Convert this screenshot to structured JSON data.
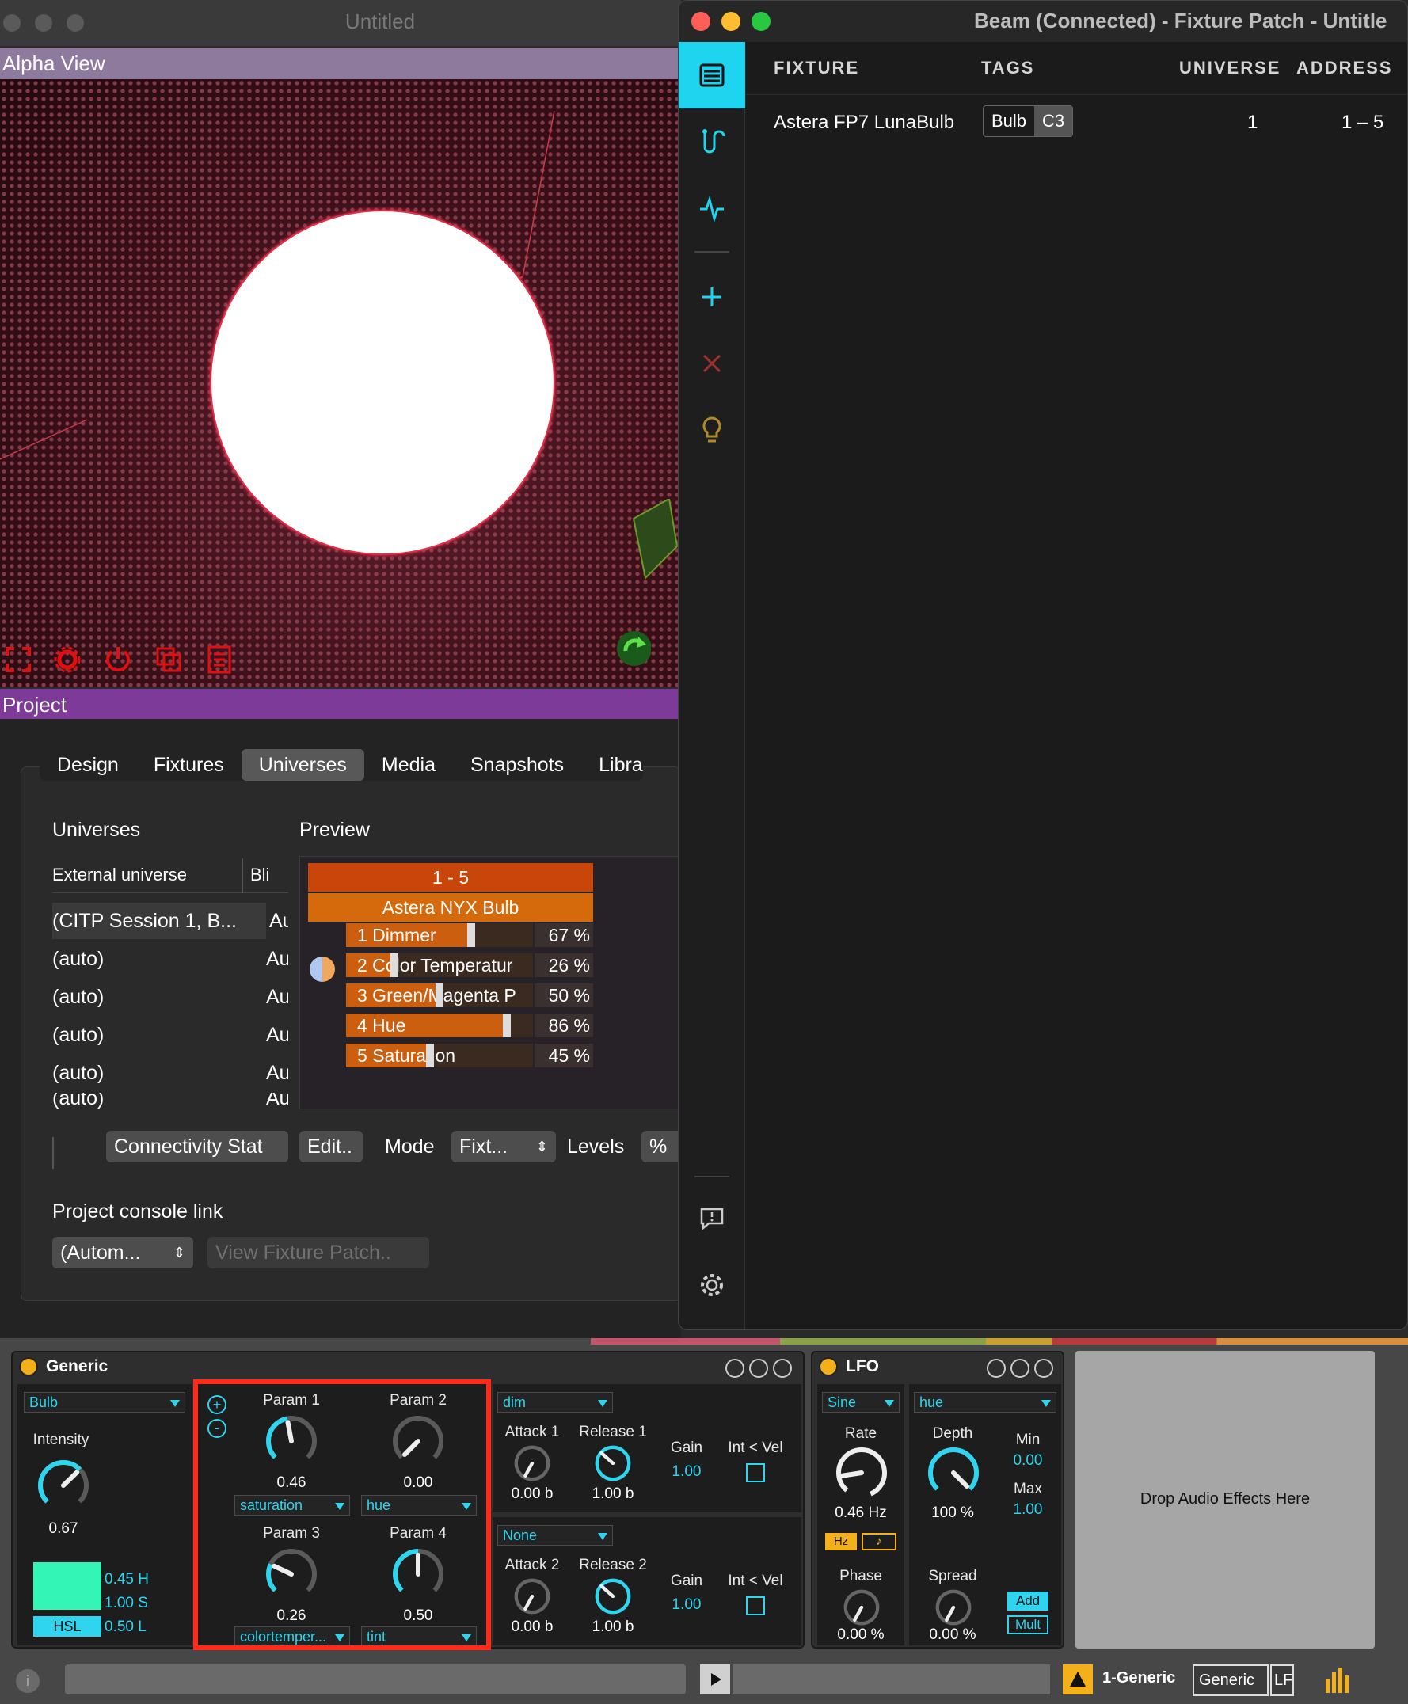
{
  "left_window": {
    "title": "Untitled",
    "alpha_view_label": "Alpha View",
    "project_label": "Project",
    "tabs": [
      "Design",
      "Fixtures",
      "Universes",
      "Media",
      "Snapshots",
      "Libra"
    ],
    "selected_tab": "Universes",
    "universes_heading": "Universes",
    "preview_heading": "Preview",
    "universe_table": {
      "headers": [
        "External universe",
        "Bli"
      ],
      "rows": [
        {
          "name": "(CITP Session 1, B...",
          "col2": "Au"
        },
        {
          "name": "(auto)",
          "col2": "Au"
        },
        {
          "name": "(auto)",
          "col2": "Au"
        },
        {
          "name": "(auto)",
          "col2": "Au"
        },
        {
          "name": "(auto)",
          "col2": "Au"
        },
        {
          "name": "(auto)",
          "col2": "Au"
        }
      ]
    },
    "preview": {
      "address_range": "1 - 5",
      "fixture_name": "Astera NYX Bulb",
      "channels": [
        {
          "label": "1 Dimmer",
          "value": "67 %",
          "level": 0.67
        },
        {
          "label": "2 Color Temperatur",
          "value": "26 %",
          "level": 0.26
        },
        {
          "label": "3 Green/Magenta P",
          "value": "50 %",
          "level": 0.5
        },
        {
          "label": "4 Hue",
          "value": "86 %",
          "level": 0.86
        },
        {
          "label": "5 Saturation",
          "value": "45 %",
          "level": 0.45
        }
      ]
    },
    "controls": {
      "connectivity_button": "Connectivity Stat",
      "edit_button": "Edit..",
      "mode_label": "Mode",
      "mode_value": "Fixt...",
      "levels_label": "Levels",
      "levels_value": "%"
    },
    "console_link": {
      "label": "Project console link",
      "select_value": "(Autom...",
      "view_button": "View Fixture Patch.."
    }
  },
  "beam_window": {
    "title": "Beam (Connected) - Fixture Patch - Untitle",
    "columns": [
      "FIXTURE",
      "TAGS",
      "UNIVERSE",
      "ADDRESS"
    ],
    "rows": [
      {
        "fixture": "Astera FP7 LunaBulb",
        "tags": [
          "Bulb",
          "C3"
        ],
        "universe": "1",
        "address": "1 – 5"
      }
    ]
  },
  "ableton": {
    "generic_device": {
      "title": "Generic",
      "fixture_select": "Bulb",
      "intensity_label": "Intensity",
      "intensity_value": "0.67",
      "intensity_level": 0.67,
      "color_hex": "#33f5b6",
      "mode_label": "HSL",
      "h_value": "0.45 H",
      "s_value": "1.00 S",
      "l_value": "0.50 L",
      "params": [
        {
          "label": "Param 1",
          "value": "0.46",
          "level": 0.46,
          "assign": "saturation"
        },
        {
          "label": "Param 2",
          "value": "0.00",
          "level": 0.0,
          "assign": "hue"
        },
        {
          "label": "Param 3",
          "value": "0.26",
          "level": 0.26,
          "assign": "colortemper..."
        },
        {
          "label": "Param 4",
          "value": "0.50",
          "level": 0.5,
          "assign": "tint"
        }
      ],
      "envelopes": [
        {
          "source": "dim",
          "attack_label": "Attack 1",
          "attack_value": "0.00 b",
          "release_label": "Release 1",
          "release_value": "1.00 b",
          "gain_label": "Gain",
          "gain_value": "1.00",
          "intvel_label": "Int < Vel"
        },
        {
          "source": "None",
          "attack_label": "Attack 2",
          "attack_value": "0.00 b",
          "release_label": "Release 2",
          "release_value": "1.00 b",
          "gain_label": "Gain",
          "gain_value": "1.00",
          "intvel_label": "Int < Vel"
        }
      ]
    },
    "lfo_device": {
      "title": "LFO",
      "waveform": "Sine",
      "target": "hue",
      "rate_label": "Rate",
      "rate_value": "0.46 Hz",
      "hz_button": "Hz",
      "note_button": "♪",
      "depth_label": "Depth",
      "depth_value": "100 %",
      "depth_level": 1.0,
      "min_label": "Min",
      "min_value": "0.00",
      "max_label": "Max",
      "max_value": "1.00",
      "phase_label": "Phase",
      "phase_value": "0.00 %",
      "spread_label": "Spread",
      "spread_value": "0.00 %",
      "add_button": "Add",
      "mult_button": "Mult"
    },
    "drop_zone": "Drop Audio Effects Here",
    "status_bar": {
      "track_name": "1-Generic",
      "tab1": "Generic",
      "tab2": "LFO"
    },
    "colors": {
      "accent": "#2fd4ee",
      "highlight_box": "#ff2a1a",
      "power": "#f3b01a"
    }
  }
}
